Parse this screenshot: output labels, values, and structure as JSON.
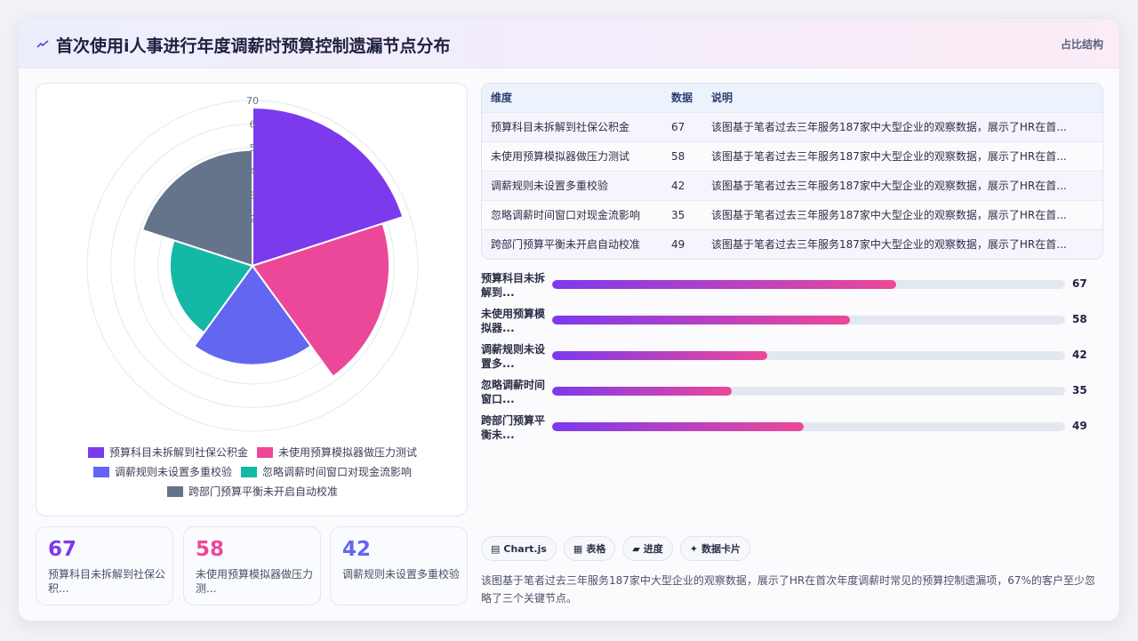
{
  "header": {
    "title": "首次使用i人事进行年度调薪时预算控制遗漏节点分布",
    "right_label": "占比结构"
  },
  "colors": {
    "series": [
      "#7c3aed",
      "#ec4899",
      "#6366f1",
      "#14b8a6",
      "#64748b"
    ],
    "stat": [
      "#7c3aed",
      "#ec4899",
      "#6366f1"
    ]
  },
  "chart_data": {
    "type": "polarArea",
    "categories": [
      "预算科目未拆解到社保公积金",
      "未使用预算模拟器做压力测试",
      "调薪规则未设置多重校验",
      "忽略调薪时间窗口对现金流影响",
      "跨部门预算平衡未开启自动校准"
    ],
    "values": [
      67,
      58,
      42,
      35,
      49
    ],
    "rlim": [
      0,
      70
    ],
    "tick_labels": [
      "70",
      "6",
      "5",
      "4",
      "3",
      "2"
    ],
    "legend_position": "bottom"
  },
  "table": {
    "headers": [
      "维度",
      "数据",
      "说明"
    ],
    "rows": [
      {
        "name": "预算科目未拆解到社保公积金",
        "value": "67",
        "desc": "该图基于笔者过去三年服务187家中大型企业的观察数据，展示了HR在首..."
      },
      {
        "name": "未使用预算模拟器做压力测试",
        "value": "58",
        "desc": "该图基于笔者过去三年服务187家中大型企业的观察数据，展示了HR在首..."
      },
      {
        "name": "调薪规则未设置多重校验",
        "value": "42",
        "desc": "该图基于笔者过去三年服务187家中大型企业的观察数据，展示了HR在首..."
      },
      {
        "name": "忽略调薪时间窗口对现金流影响",
        "value": "35",
        "desc": "该图基于笔者过去三年服务187家中大型企业的观察数据，展示了HR在首..."
      },
      {
        "name": "跨部门预算平衡未开启自动校准",
        "value": "49",
        "desc": "该图基于笔者过去三年服务187家中大型企业的观察数据，展示了HR在首..."
      }
    ]
  },
  "bars": [
    {
      "label": "预算科目未拆解到...",
      "value": 67
    },
    {
      "label": "未使用预算模拟器...",
      "value": 58
    },
    {
      "label": "调薪规则未设置多...",
      "value": 42
    },
    {
      "label": "忽略调薪时间窗口...",
      "value": 35
    },
    {
      "label": "跨部门预算平衡未...",
      "value": 49
    }
  ],
  "bar_max": 100,
  "stats": [
    {
      "value": "67",
      "label": "预算科目未拆解到社保公积..."
    },
    {
      "value": "58",
      "label": "未使用预算模拟器做压力测..."
    },
    {
      "value": "42",
      "label": "调薪规则未设置多重校验"
    }
  ],
  "tags": [
    {
      "icon": "▤",
      "label": "Chart.js"
    },
    {
      "icon": "▦",
      "label": "表格"
    },
    {
      "icon": "▰",
      "label": "进度"
    },
    {
      "icon": "✦",
      "label": "数据卡片"
    }
  ],
  "summary": "该图基于笔者过去三年服务187家中大型企业的观察数据，展示了HR在首次年度调薪时常见的预算控制遗漏项，67%的客户至少忽略了三个关键节点。"
}
